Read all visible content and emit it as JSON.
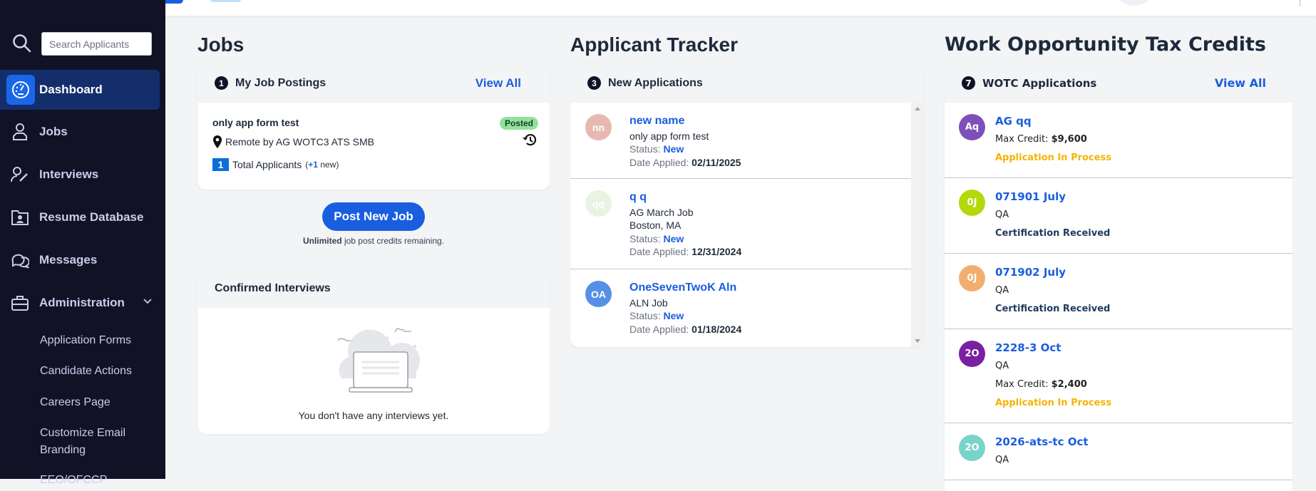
{
  "sidebar": {
    "search_placeholder": "Search Applicants",
    "items": [
      {
        "label": "Dashboard",
        "icon": "dashboard-gauge-icon"
      },
      {
        "label": "Jobs",
        "icon": "jobs-person-icon"
      },
      {
        "label": "Interviews",
        "icon": "interviews-user-edit-icon"
      },
      {
        "label": "Resume Database",
        "icon": "resume-folder-icon"
      },
      {
        "label": "Messages",
        "icon": "messages-chat-icon"
      },
      {
        "label": "Administration",
        "icon": "toolbox-icon"
      }
    ],
    "sub_items": [
      "Application Forms",
      "Candidate Actions",
      "Careers Page",
      "Customize Email Branding",
      "EEO/OFCCP"
    ]
  },
  "jobs": {
    "heading": "Jobs",
    "postings": {
      "count": "1",
      "title": "My Job Postings",
      "view_all": "View All",
      "job": {
        "title": "only app form test",
        "status": "Posted",
        "location": "Remote by AG WOTC3 ATS SMB",
        "applicants": "1",
        "applicants_label": "Total Applicants",
        "new_open": "(",
        "new_count": "+1",
        "new_label": " new)"
      }
    },
    "post_button": "Post New Job",
    "credits_bold": "Unlimited",
    "credits_text": " job post credits remaining.",
    "interviews": {
      "title": "Confirmed Interviews",
      "empty": "You don't have any interviews yet."
    }
  },
  "tracker": {
    "heading": "Applicant Tracker",
    "count": "3",
    "title": "New Applications",
    "status_label": "Status: ",
    "date_label": "Date Applied: ",
    "rows": [
      {
        "initials": "nn",
        "color": "#e6b8b0",
        "name": "new name",
        "lines": [
          "only app form test"
        ],
        "status": "New",
        "date": "02/11/2025"
      },
      {
        "initials": "qq",
        "color": "#e6f4e1",
        "name": "q q",
        "lines": [
          "AG March Job",
          "Boston, MA"
        ],
        "status": "New",
        "date": "12/31/2024"
      },
      {
        "initials": "OA",
        "color": "#5590e6",
        "name": "OneSevenTwoK Aln",
        "lines": [
          "ALN Job"
        ],
        "status": "New",
        "date": "01/18/2024"
      }
    ]
  },
  "wotc": {
    "heading": "Work Opportunity Tax Credits",
    "count": "7",
    "title": "WOTC Applications",
    "view_all": "View All",
    "max_label": "Max Credit: ",
    "rows": [
      {
        "initials": "Aq",
        "color": "#7e4fbb",
        "name": "AG qq",
        "sub": null,
        "max": "$9,600",
        "status": "Application In Process",
        "status_color": "#f5b400"
      },
      {
        "initials": "0J",
        "color": "#b3d90a",
        "name": "071901 July",
        "sub": "QA",
        "max": null,
        "status": "Certification Received",
        "status_color": "#1e3a5f"
      },
      {
        "initials": "0J",
        "color": "#f2ae6e",
        "name": "071902 July",
        "sub": "QA",
        "max": null,
        "status": "Certification Received",
        "status_color": "#1e3a5f"
      },
      {
        "initials": "2O",
        "color": "#7a1fa2",
        "name": "2228-3 Oct",
        "sub": "QA",
        "max": "$2,400",
        "status": "Application In Process",
        "status_color": "#f5b400"
      },
      {
        "initials": "2O",
        "color": "#79d3c9",
        "name": "2026-ats-tc Oct",
        "sub": "QA",
        "max": null,
        "status": null,
        "status_color": null
      }
    ]
  }
}
